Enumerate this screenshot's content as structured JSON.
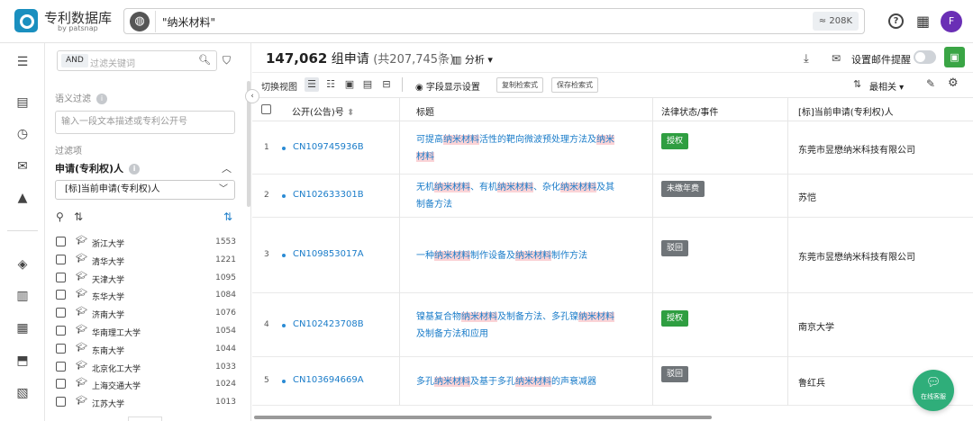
{
  "app": {
    "title": "专利数据库",
    "subtitle": "by patsnap"
  },
  "search": {
    "query": "\"纳米材料\"",
    "count": "≈ 208K"
  },
  "user": {
    "avatar_initial": "F"
  },
  "colors": {
    "accent": "#1a7cc9",
    "grant": "#2f9e41",
    "gray_status": "#6f7478",
    "highlight": "#fbd3d6",
    "avatar": "#6a2fb5"
  },
  "filter": {
    "and_label": "AND",
    "keyword_placeholder": "过滤关键词",
    "semantic_label": "语义过滤",
    "semantic_placeholder": "输入一段文本描述或专利公开号",
    "filter_items_label": "过滤项",
    "assignee_label": "申请(专利权)人",
    "assignee_select": "[标]当前申请(专利权)人",
    "items": [
      {
        "name": "浙江大学",
        "count": "1553"
      },
      {
        "name": "清华大学",
        "count": "1221"
      },
      {
        "name": "天津大学",
        "count": "1095"
      },
      {
        "name": "东华大学",
        "count": "1084"
      },
      {
        "name": "济南大学",
        "count": "1076"
      },
      {
        "name": "华南理工大学",
        "count": "1054"
      },
      {
        "name": "东南大学",
        "count": "1044"
      },
      {
        "name": "北京化工大学",
        "count": "1033"
      },
      {
        "name": "上海交通大学",
        "count": "1024"
      },
      {
        "name": "江苏大学",
        "count": "1013"
      }
    ]
  },
  "results": {
    "count": "147,062",
    "unit": "组申请",
    "sub": "(共207,745条)",
    "analysis": "分析",
    "alert_label": "设置邮件提醒"
  },
  "toolbar": {
    "switch_view": "切换视图",
    "fields": "字段显示设置",
    "copy_query": "复制检索式",
    "save_query": "保存检索式",
    "sort": "最相关"
  },
  "table": {
    "headers": {
      "pubno": "公开(公告)号",
      "title": "标题",
      "status": "法律状态/事件",
      "assignee": "[标]当前申请(专利权)人"
    },
    "rows": [
      {
        "idx": "1",
        "pubno": "CN109745936B",
        "title": [
          {
            "t": "可提高"
          },
          {
            "t": "纳米材料",
            "h": true
          },
          {
            "t": "活性的靶向微波预处理方法及"
          },
          {
            "t": "纳米材料",
            "h": true
          }
        ],
        "status": "授权",
        "status_type": "grant",
        "assignee": "东莞市昱懋纳米科技有限公司"
      },
      {
        "idx": "2",
        "pubno": "CN102633301B",
        "title": [
          {
            "t": "无机"
          },
          {
            "t": "纳米材料",
            "h": true
          },
          {
            "t": "、有机"
          },
          {
            "t": "纳米材料",
            "h": true
          },
          {
            "t": "、杂化"
          },
          {
            "t": "纳米材料",
            "h": true
          },
          {
            "t": "及其制备方法"
          }
        ],
        "status": "未缴年费",
        "status_type": "gray",
        "assignee": "苏恺"
      },
      {
        "idx": "3",
        "pubno": "CN109853017A",
        "title": [
          {
            "t": "一种"
          },
          {
            "t": "纳米材料",
            "h": true
          },
          {
            "t": "制作设备及"
          },
          {
            "t": "纳米材料",
            "h": true
          },
          {
            "t": "制作方法"
          }
        ],
        "status": "驳回",
        "status_type": "gray",
        "assignee": "东莞市昱懋纳米科技有限公司"
      },
      {
        "idx": "4",
        "pubno": "CN102423708B",
        "title": [
          {
            "t": "镍基复合物"
          },
          {
            "t": "纳米材料",
            "h": true
          },
          {
            "t": "及制备方法、多孔镍"
          },
          {
            "t": "纳米材料",
            "h": true
          },
          {
            "t": "及制备方法和应用"
          }
        ],
        "status": "授权",
        "status_type": "grant",
        "assignee": "南京大学"
      },
      {
        "idx": "5",
        "pubno": "CN103694669A",
        "title": [
          {
            "t": "多孔"
          },
          {
            "t": "纳米材料",
            "h": true
          },
          {
            "t": "及基于多孔"
          },
          {
            "t": "纳米材料",
            "h": true
          },
          {
            "t": "的声衰减器"
          }
        ],
        "status": "驳回",
        "status_type": "gray",
        "assignee": "鲁红兵"
      }
    ]
  },
  "chat": {
    "label": "在线客服"
  }
}
